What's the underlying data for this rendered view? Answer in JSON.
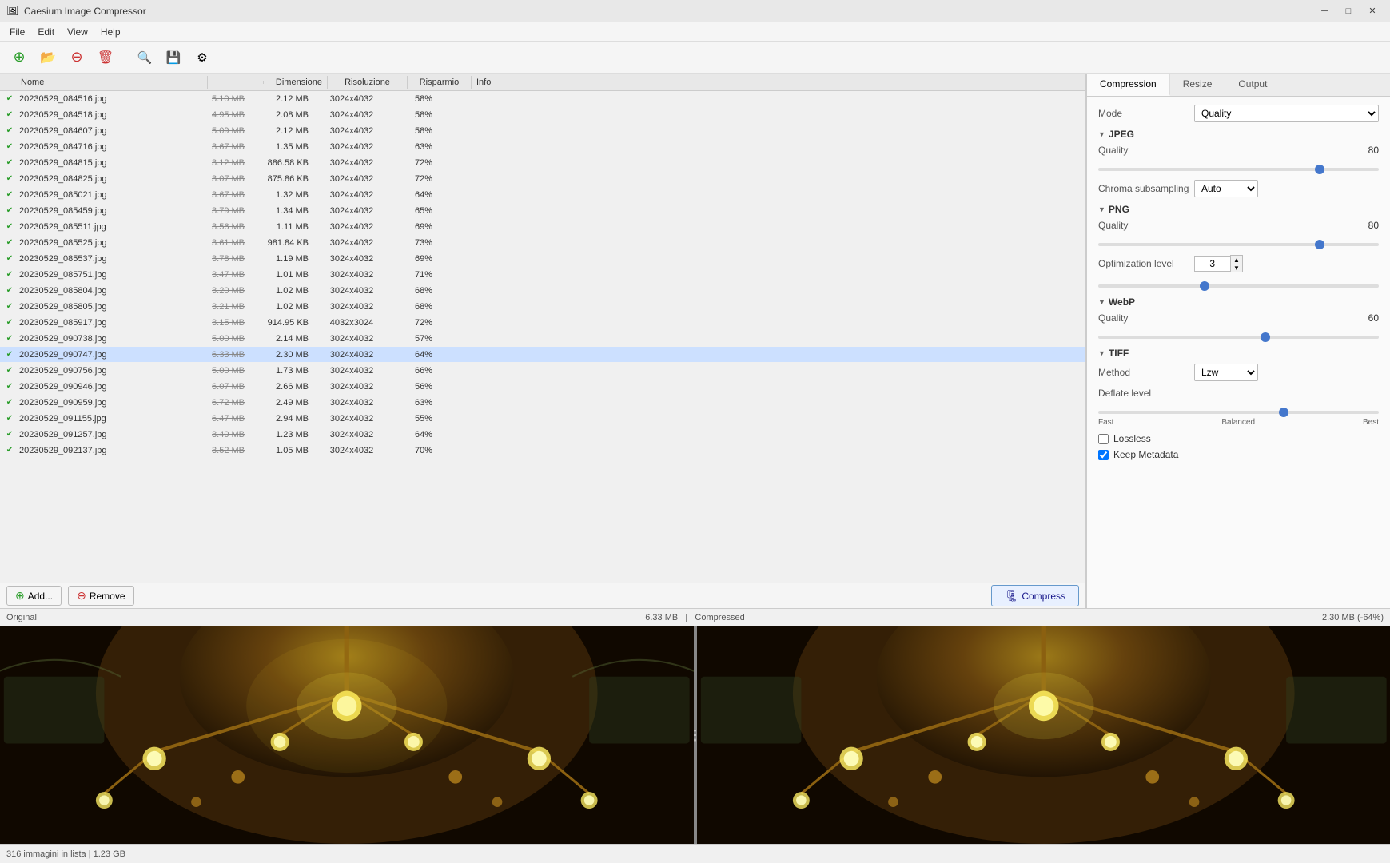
{
  "app": {
    "title": "Caesium Image Compressor",
    "icon": "🖼"
  },
  "titlebar": {
    "minimize": "─",
    "maximize": "□",
    "close": "✕"
  },
  "menu": {
    "items": [
      "File",
      "Edit",
      "View",
      "Help"
    ]
  },
  "toolbar": {
    "buttons": [
      {
        "name": "add-folder",
        "icon": "📂",
        "title": "Add folder"
      },
      {
        "name": "add-files",
        "icon": "📁",
        "title": "Add files"
      },
      {
        "name": "remove-red",
        "icon": "🔴",
        "title": "Remove"
      },
      {
        "name": "clear",
        "icon": "🗑",
        "title": "Clear"
      },
      {
        "name": "search",
        "icon": "🔍",
        "title": "Search"
      },
      {
        "name": "export",
        "icon": "💾",
        "title": "Export"
      },
      {
        "name": "settings",
        "icon": "⚙",
        "title": "Settings"
      }
    ]
  },
  "file_list": {
    "columns": {
      "nome": "Nome",
      "dimensione": "Dimensione",
      "risoluzione": "Risoluzione",
      "risparmio": "Risparmio",
      "info": "Info"
    },
    "files": [
      {
        "name": "20230529_084516.jpg",
        "orig": "5.10 MB",
        "comp": "2.12 MB",
        "res": "3024x4032",
        "savings": "58%",
        "info": ""
      },
      {
        "name": "20230529_084518.jpg",
        "orig": "4.95 MB",
        "comp": "2.08 MB",
        "res": "3024x4032",
        "savings": "58%",
        "info": ""
      },
      {
        "name": "20230529_084607.jpg",
        "orig": "5.09 MB",
        "comp": "2.12 MB",
        "res": "3024x4032",
        "savings": "58%",
        "info": ""
      },
      {
        "name": "20230529_084716.jpg",
        "orig": "3.67 MB",
        "comp": "1.35 MB",
        "res": "3024x4032",
        "savings": "63%",
        "info": ""
      },
      {
        "name": "20230529_084815.jpg",
        "orig": "3.12 MB",
        "comp": "886.58 KB",
        "res": "3024x4032",
        "savings": "72%",
        "info": ""
      },
      {
        "name": "20230529_084825.jpg",
        "orig": "3.07 MB",
        "comp": "875.86 KB",
        "res": "3024x4032",
        "savings": "72%",
        "info": ""
      },
      {
        "name": "20230529_085021.jpg",
        "orig": "3.67 MB",
        "comp": "1.32 MB",
        "res": "3024x4032",
        "savings": "64%",
        "info": ""
      },
      {
        "name": "20230529_085459.jpg",
        "orig": "3.79 MB",
        "comp": "1.34 MB",
        "res": "3024x4032",
        "savings": "65%",
        "info": ""
      },
      {
        "name": "20230529_085511.jpg",
        "orig": "3.56 MB",
        "comp": "1.11 MB",
        "res": "3024x4032",
        "savings": "69%",
        "info": ""
      },
      {
        "name": "20230529_085525.jpg",
        "orig": "3.61 MB",
        "comp": "981.84 KB",
        "res": "3024x4032",
        "savings": "73%",
        "info": ""
      },
      {
        "name": "20230529_085537.jpg",
        "orig": "3.78 MB",
        "comp": "1.19 MB",
        "res": "3024x4032",
        "savings": "69%",
        "info": ""
      },
      {
        "name": "20230529_085751.jpg",
        "orig": "3.47 MB",
        "comp": "1.01 MB",
        "res": "3024x4032",
        "savings": "71%",
        "info": ""
      },
      {
        "name": "20230529_085804.jpg",
        "orig": "3.20 MB",
        "comp": "1.02 MB",
        "res": "3024x4032",
        "savings": "68%",
        "info": ""
      },
      {
        "name": "20230529_085805.jpg",
        "orig": "3.21 MB",
        "comp": "1.02 MB",
        "res": "3024x4032",
        "savings": "68%",
        "info": ""
      },
      {
        "name": "20230529_085917.jpg",
        "orig": "3.15 MB",
        "comp": "914.95 KB",
        "res": "4032x3024",
        "savings": "72%",
        "info": ""
      },
      {
        "name": "20230529_090738.jpg",
        "orig": "5.00 MB",
        "comp": "2.14 MB",
        "res": "3024x4032",
        "savings": "57%",
        "info": ""
      },
      {
        "name": "20230529_090747.jpg",
        "orig": "6.33 MB",
        "comp": "2.30 MB",
        "res": "3024x4032",
        "savings": "64%",
        "info": "",
        "selected": true
      },
      {
        "name": "20230529_090756.jpg",
        "orig": "5.00 MB",
        "comp": "1.73 MB",
        "res": "3024x4032",
        "savings": "66%",
        "info": ""
      },
      {
        "name": "20230529_090946.jpg",
        "orig": "6.07 MB",
        "comp": "2.66 MB",
        "res": "3024x4032",
        "savings": "56%",
        "info": ""
      },
      {
        "name": "20230529_090959.jpg",
        "orig": "6.72 MB",
        "comp": "2.49 MB",
        "res": "3024x4032",
        "savings": "63%",
        "info": ""
      },
      {
        "name": "20230529_091155.jpg",
        "orig": "6.47 MB",
        "comp": "2.94 MB",
        "res": "3024x4032",
        "savings": "55%",
        "info": ""
      },
      {
        "name": "20230529_091257.jpg",
        "orig": "3.40 MB",
        "comp": "1.23 MB",
        "res": "3024x4032",
        "savings": "64%",
        "info": ""
      },
      {
        "name": "20230529_092137.jpg",
        "orig": "3.52 MB",
        "comp": "1.05 MB",
        "res": "3024x4032",
        "savings": "70%",
        "info": ""
      }
    ]
  },
  "bottom_bar": {
    "add_label": "Add...",
    "remove_label": "Remove",
    "compress_label": "Compress"
  },
  "right_panel": {
    "tabs": [
      "Compression",
      "Resize",
      "Output"
    ],
    "active_tab": "Compression",
    "mode_label": "Mode",
    "mode_value": "Quality",
    "sections": {
      "jpeg": {
        "title": "JPEG",
        "quality_label": "Quality",
        "quality_value": 80,
        "quality_pct": 80,
        "chroma_label": "Chroma subsampling",
        "chroma_value": "Auto"
      },
      "png": {
        "title": "PNG",
        "quality_label": "Quality",
        "quality_value": 80,
        "quality_pct": 80,
        "opt_label": "Optimization level",
        "opt_value": 3,
        "opt_pct": 37
      },
      "webp": {
        "title": "WebP",
        "quality_label": "Quality",
        "quality_value": 60,
        "quality_pct": 60
      },
      "tiff": {
        "title": "TIFF",
        "method_label": "Method",
        "method_value": "Lzw",
        "deflate_label": "Deflate level",
        "deflate_labels": [
          "Fast",
          "Balanced",
          "Best"
        ]
      }
    },
    "lossless_label": "Lossless",
    "lossless_checked": false,
    "keep_metadata_label": "Keep Metadata",
    "keep_metadata_checked": true
  },
  "preview": {
    "orig_label": "Original",
    "orig_size": "6.33 MB",
    "comp_label": "Compressed",
    "comp_size": "2.30 MB (-64%)"
  },
  "status_bar": {
    "text": "316 immagini in lista | 1.23 GB"
  }
}
